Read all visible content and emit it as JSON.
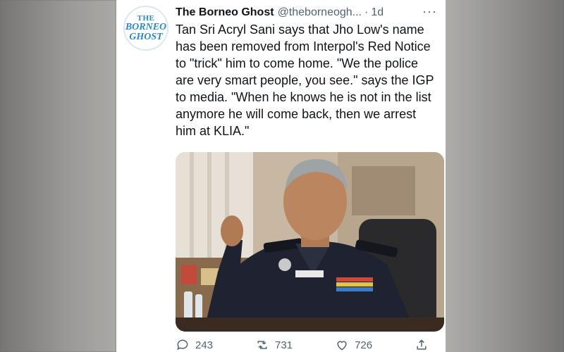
{
  "tweet": {
    "account_name": "The Borneo Ghost",
    "handle": "@theborneogh...",
    "separator": "·",
    "time": "1d",
    "more_label": "···",
    "text": "Tan Sri Acryl Sani says that Jho Low's name has been removed from Interpol's Red Notice to \"trick\" him to come home. \"We the police are very smart people, you see.\" says the IGP to media. \"When he knows he is not in the list anymore he will come back, then we arrest him at KLIA.\"",
    "avatar_logo": [
      "THE",
      "BORNEO",
      "GHOST"
    ]
  },
  "actions": {
    "replies": "243",
    "retweets": "731",
    "likes": "726"
  },
  "icons": [
    "reply-icon",
    "retweet-icon",
    "like-icon",
    "share-icon"
  ],
  "colors": {
    "text": "#0f1419",
    "muted": "#536471",
    "logo_blue": "#2a8ac9"
  }
}
